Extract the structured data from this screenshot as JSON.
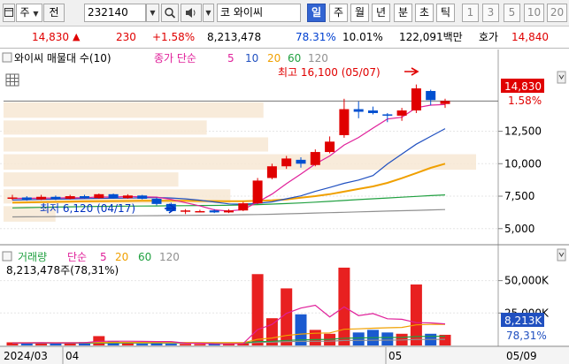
{
  "toolbar": {
    "market_label": "주",
    "prev_label": "전",
    "code": "232140",
    "stock_name": "와이씨",
    "stock_prefix": "코",
    "periods": [
      "일",
      "주",
      "월",
      "년",
      "분",
      "초",
      "틱"
    ],
    "active_period": "일",
    "intervals": [
      "1",
      "3",
      "5",
      "10",
      "20"
    ]
  },
  "quote": {
    "price": "14,830",
    "change": "230",
    "change_pct": "+1.58%",
    "volume": "8,213,478",
    "vol_ratio": "78.31%",
    "turnover": "10.01%",
    "amount": "122,091백만",
    "ask_label": "호가",
    "ask_price": "14,840"
  },
  "price_panel": {
    "title": "와이씨 매물대 수(10)",
    "ma_label": "종가 단순",
    "ma_periods": [
      "5",
      "10",
      "20",
      "60",
      "120"
    ],
    "ma_colors": [
      "#e0209a",
      "#2050c0",
      "#f0a000",
      "#20a040",
      "#909090"
    ],
    "high_annotation": "최고 16,100 (05/07)",
    "low_annotation": "최저 6,120 (04/17)",
    "current_price_tag": "14,830",
    "current_pct_tag": "1.58%"
  },
  "volume_panel": {
    "title": "거래량",
    "ma_label": "단순",
    "ma_periods": [
      "5",
      "20",
      "60",
      "120"
    ],
    "ma_colors": [
      "#e0209a",
      "#f0a000",
      "#20a040",
      "#909090"
    ],
    "volume_info": "8,213,478주(78,31%)",
    "current_volume_tag": "8,213K",
    "current_pct_tag": "78,31%"
  },
  "x_axis": {
    "labels": [
      "2024/03",
      "04",
      "05",
      "05/09"
    ]
  },
  "chart_data": {
    "type": "candlestick",
    "price_axis": {
      "ticks": [
        5000,
        7500,
        10000,
        12500
      ],
      "tick_labels": [
        "5,000",
        "7,500",
        "10,000",
        "12,500"
      ],
      "range": [
        4100,
        17300
      ]
    },
    "volume_axis": {
      "ticks": [
        25000,
        50000
      ],
      "tick_labels": [
        "25,000K",
        "50,000K"
      ],
      "range": [
        0,
        62000
      ]
    },
    "candles": [
      {
        "o": 7300,
        "c": 7400,
        "h": 7600,
        "l": 7200
      },
      {
        "o": 7400,
        "c": 7250,
        "h": 7500,
        "l": 7150
      },
      {
        "o": 7250,
        "c": 7450,
        "h": 7600,
        "l": 7200
      },
      {
        "o": 7450,
        "c": 7300,
        "h": 7550,
        "l": 7200
      },
      {
        "o": 7300,
        "c": 7500,
        "h": 7600,
        "l": 7250
      },
      {
        "o": 7500,
        "c": 7350,
        "h": 7600,
        "l": 7300
      },
      {
        "o": 7350,
        "c": 7650,
        "h": 7700,
        "l": 7300
      },
      {
        "o": 7650,
        "c": 7350,
        "h": 7700,
        "l": 7300
      },
      {
        "o": 7350,
        "c": 7550,
        "h": 7650,
        "l": 7300
      },
      {
        "o": 7550,
        "c": 7300,
        "h": 7600,
        "l": 7250
      },
      {
        "o": 7300,
        "c": 6900,
        "h": 7400,
        "l": 6800
      },
      {
        "o": 6900,
        "c": 6350,
        "h": 7000,
        "l": 6300
      },
      {
        "o": 6350,
        "c": 6400,
        "h": 6500,
        "l": 6120
      },
      {
        "o": 6300,
        "c": 6350,
        "h": 6450,
        "l": 6250
      },
      {
        "o": 6400,
        "c": 6250,
        "h": 6500,
        "l": 6200
      },
      {
        "o": 6250,
        "c": 6400,
        "h": 6500,
        "l": 6200
      },
      {
        "o": 6400,
        "c": 6950,
        "h": 7050,
        "l": 6350
      },
      {
        "o": 6950,
        "c": 8700,
        "h": 8900,
        "l": 6900
      },
      {
        "o": 8900,
        "c": 9800,
        "h": 10000,
        "l": 8800
      },
      {
        "o": 9800,
        "c": 10400,
        "h": 10600,
        "l": 9600
      },
      {
        "o": 10300,
        "c": 10000,
        "h": 10500,
        "l": 9700
      },
      {
        "o": 9900,
        "c": 10900,
        "h": 11100,
        "l": 9800
      },
      {
        "o": 10900,
        "c": 11700,
        "h": 12100,
        "l": 10800
      },
      {
        "o": 12200,
        "c": 14200,
        "h": 15000,
        "l": 12000
      },
      {
        "o": 14200,
        "c": 14000,
        "h": 14800,
        "l": 13500
      },
      {
        "o": 14100,
        "c": 13900,
        "h": 14400,
        "l": 13800
      },
      {
        "o": 13800,
        "c": 13700,
        "h": 13900,
        "l": 13200
      },
      {
        "o": 13700,
        "c": 14100,
        "h": 14300,
        "l": 13300
      },
      {
        "o": 14100,
        "c": 15800,
        "h": 16100,
        "l": 13900
      },
      {
        "o": 15600,
        "c": 14900,
        "h": 15700,
        "l": 14500
      },
      {
        "o": 14600,
        "c": 14830,
        "h": 15000,
        "l": 14300
      }
    ],
    "volumes": [
      2400,
      1700,
      2200,
      1800,
      2000,
      2600,
      7200,
      3000,
      1700,
      1300,
      1800,
      1300,
      1200,
      1100,
      1300,
      1200,
      2200,
      55000,
      21000,
      44000,
      24000,
      12000,
      9000,
      60000,
      10000,
      12000,
      10000,
      9000,
      47000,
      9000,
      8213
    ],
    "price_ma": {
      "5": [
        7330,
        7330,
        7350,
        7360,
        7380,
        7370,
        7450,
        7430,
        7480,
        7450,
        7430,
        7250,
        7000,
        6750,
        6450,
        6350,
        6470,
        7040,
        7660,
        8460,
        9200,
        9980,
        10600,
        11440,
        12020,
        12740,
        13440,
        13580,
        14310,
        14510,
        14560
      ],
      "10": [
        7200,
        7220,
        7250,
        7270,
        7290,
        7310,
        7330,
        7340,
        7350,
        7370,
        7390,
        7360,
        7290,
        7190,
        7050,
        6900,
        6880,
        6950,
        7060,
        7300,
        7520,
        7870,
        8170,
        8490,
        8740,
        9090,
        9980,
        10740,
        11500,
        12100,
        12700
      ],
      "20": [
        7000,
        7020,
        7040,
        7060,
        7080,
        7100,
        7110,
        7120,
        7130,
        7140,
        7150,
        7150,
        7150,
        7130,
        7120,
        7110,
        7110,
        7140,
        7180,
        7250,
        7380,
        7500,
        7650,
        7850,
        8050,
        8250,
        8520,
        8880,
        9280,
        9680,
        10000
      ],
      "60": [
        6600,
        6620,
        6640,
        6660,
        6680,
        6700,
        6710,
        6720,
        6730,
        6740,
        6750,
        6760,
        6770,
        6780,
        6790,
        6800,
        6820,
        6850,
        6890,
        6930,
        6980,
        7040,
        7100,
        7170,
        7240,
        7300,
        7360,
        7420,
        7480,
        7540,
        7600
      ],
      "120": [
        5900,
        5910,
        5920,
        5930,
        5940,
        5950,
        5960,
        5970,
        5980,
        5990,
        6000,
        6010,
        6020,
        6030,
        6040,
        6050,
        6070,
        6090,
        6110,
        6140,
        6170,
        6200,
        6230,
        6260,
        6290,
        6320,
        6350,
        6380,
        6410,
        6440,
        6470
      ]
    },
    "volume_ma": {
      "5": [
        2000,
        2000,
        2100,
        2000,
        2020,
        2100,
        3200,
        3300,
        3300,
        3100,
        3000,
        3000,
        1800,
        1700,
        1300,
        1200,
        1400,
        12200,
        16200,
        24700,
        28800,
        31000,
        22000,
        29800,
        23000,
        24600,
        20600,
        20200,
        17600,
        17400,
        16600
      ],
      "20": [
        2100,
        2100,
        2100,
        2120,
        2140,
        2160,
        2300,
        2380,
        2380,
        2350,
        2300,
        2280,
        2250,
        2200,
        2150,
        2100,
        2100,
        4700,
        5700,
        7700,
        8800,
        9400,
        9700,
        12500,
        12800,
        13300,
        13600,
        13900,
        15900,
        16200,
        16300
      ],
      "60": [
        1900,
        1900,
        1900,
        1900,
        1920,
        1940,
        2000,
        2020,
        2040,
        2050,
        2050,
        2050,
        2040,
        2030,
        2020,
        2010,
        2010,
        2900,
        3200,
        3900,
        4300,
        4500,
        4700,
        5600,
        5800,
        6000,
        6100,
        6200,
        6900,
        7000,
        7100
      ],
      "120": [
        1800,
        1800,
        1800,
        1800,
        1800,
        1810,
        1820,
        1830,
        1840,
        1850,
        1850,
        1850,
        1850,
        1850,
        1850,
        1850,
        1850,
        2300,
        2500,
        2900,
        3100,
        3200,
        3300,
        3800,
        3900,
        4000,
        4100,
        4200,
        4600,
        4600,
        4700
      ]
    },
    "volume_profile": [
      {
        "price_low": 13400,
        "price_high": 14800,
        "volume": 0.55
      },
      {
        "price_low": 12100,
        "price_high": 13400,
        "volume": 0.43
      },
      {
        "price_low": 10800,
        "price_high": 12100,
        "volume": 0.56
      },
      {
        "price_low": 9400,
        "price_high": 10800,
        "volume": 1.0
      },
      {
        "price_low": 8100,
        "price_high": 9400,
        "volume": 0.37
      },
      {
        "price_low": 6800,
        "price_high": 8100,
        "volume": 0.48
      },
      {
        "price_low": 5400,
        "price_high": 6800,
        "volume": 0.11
      }
    ]
  }
}
